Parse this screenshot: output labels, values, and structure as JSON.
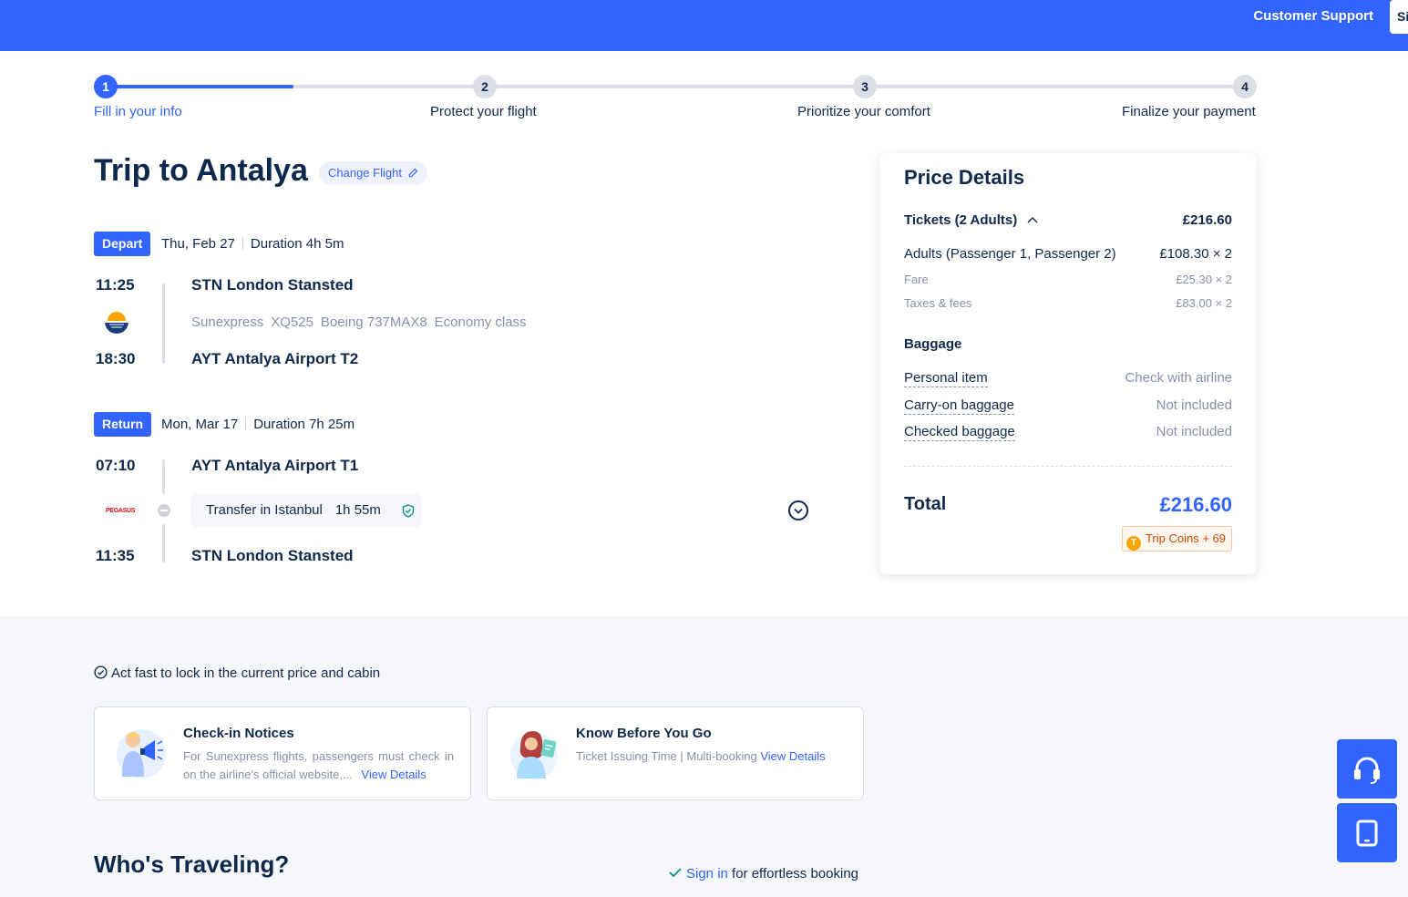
{
  "header": {
    "customer_support": "Customer Support",
    "sign_in": "Si"
  },
  "stepper": {
    "current_progress_fraction": 0.17,
    "steps": [
      {
        "number": "1",
        "label": "Fill in your info"
      },
      {
        "number": "2",
        "label": "Protect your flight"
      },
      {
        "number": "3",
        "label": "Prioritize your comfort"
      },
      {
        "number": "4",
        "label": "Finalize your payment"
      }
    ]
  },
  "trip": {
    "title": "Trip to Antalya",
    "change_flight": "Change Flight",
    "depart": {
      "badge": "Depart",
      "date": "Thu, Feb 27",
      "duration": "Duration 4h 5m",
      "dep_time": "11:25",
      "dep_airport": "STN London Stansted",
      "airline": "Sunexpress",
      "flight_no": "XQ525",
      "aircraft": "Boeing 737MAX8",
      "cabin": "Economy class",
      "arr_time": "18:30",
      "arr_airport": "AYT Antalya Airport T2"
    },
    "return": {
      "badge": "Return",
      "date": "Mon, Mar 17",
      "duration": "Duration 7h 25m",
      "dep_time": "07:10",
      "dep_airport": "AYT Antalya Airport T1",
      "airline_logo_text": "PEGASUS",
      "transfer": "Transfer in Istanbul",
      "transfer_duration": "1h 55m",
      "arr_time": "11:35",
      "arr_airport": "STN London Stansted"
    }
  },
  "price": {
    "title": "Price Details",
    "tickets_label": "Tickets (2 Adults)",
    "tickets_value": "£216.60",
    "adults_label": "Adults (Passenger 1, Passenger 2)",
    "adults_value": "£108.30 × 2",
    "fare_label": "Fare",
    "fare_value": "£25.30 × 2",
    "taxes_label": "Taxes & fees",
    "taxes_value": "£83.00 × 2",
    "baggage_title": "Baggage",
    "personal_label": "Personal item",
    "personal_value": "Check with airline",
    "carryon_label": "Carry-on baggage",
    "carryon_value": "Not included",
    "checked_label": "Checked baggage",
    "checked_value": "Not included",
    "total_label": "Total",
    "total_value": "£216.60",
    "trip_coins": "Trip Coins + 69"
  },
  "notices": {
    "act_fast": "Act fast to lock in the current price and cabin",
    "checkin_title": "Check-in Notices",
    "checkin_desc": "For Sunexpress flights, passengers must check in on the airline's official website,...",
    "know_title": "Know Before You Go",
    "know_desc": "Ticket Issuing Time | Multi-booking",
    "view_details": "View Details"
  },
  "travelers": {
    "title": "Who's Traveling?",
    "sign_in": "Sign in",
    "sign_in_suffix": " for effortless booking"
  },
  "colors": {
    "brand": "#3264ff",
    "text": "#0f294d",
    "muted": "#8592a6"
  }
}
